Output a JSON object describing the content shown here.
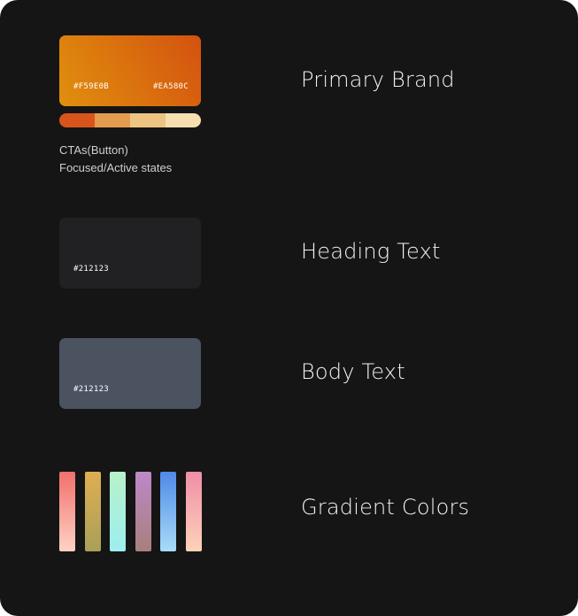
{
  "primary": {
    "label": "Primary Brand",
    "hex_start": "#F59E0B",
    "hex_end": "#EA580C",
    "gradient_start": "#e0900e",
    "gradient_end": "#d4520f",
    "scale": [
      "#d9541b",
      "#e49b4f",
      "#eec482",
      "#f6deb0"
    ],
    "desc_line1": "CTAs(Button)",
    "desc_line2": "Focused/Active states"
  },
  "heading": {
    "label": "Heading Text",
    "hex": "#212123",
    "color": "#212123"
  },
  "body": {
    "label": "Body Text",
    "hex": "#212123",
    "color": "#4b5361"
  },
  "gradient": {
    "label": "Gradient Colors",
    "bars": [
      {
        "top": "#f0706c",
        "bottom": "#ffd2c4"
      },
      {
        "top": "#e0ae52",
        "bottom": "#a8a058"
      },
      {
        "top": "#b7f2c8",
        "bottom": "#9deef0"
      },
      {
        "top": "#be88c8",
        "bottom": "#a8807c"
      },
      {
        "top": "#4f8ae8",
        "bottom": "#a8dcf8"
      },
      {
        "top": "#f08ea8",
        "bottom": "#fdd2b8"
      }
    ]
  }
}
